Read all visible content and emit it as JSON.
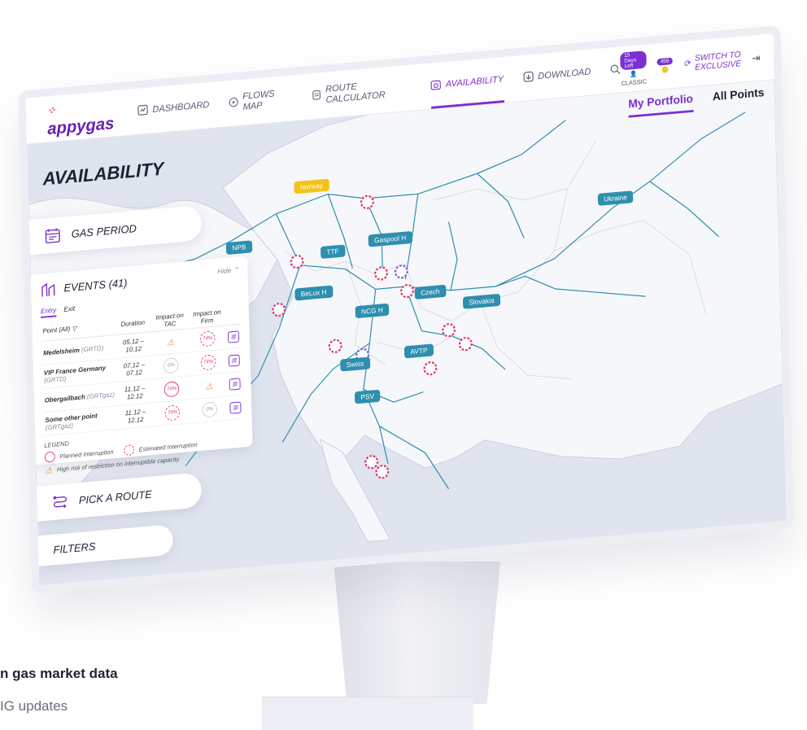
{
  "app": {
    "logo": "appygas",
    "nav": [
      "DASHBOARD",
      "FLOWS MAP",
      "ROUTE CALCULATOR",
      "AVAILABILITY",
      "DOWNLOAD"
    ],
    "active_nav": "AVAILABILITY",
    "user": {
      "days_left": "15 Days Left",
      "plan": "CLASSIC",
      "credits": "456"
    },
    "switch_label_1": "SWITCH TO",
    "switch_label_2": "EXCLUSIVE",
    "view_tabs": {
      "portfolio": "My Portfolio",
      "all": "All Points"
    }
  },
  "page": {
    "title": "AVAILABILITY",
    "gas_period": "GAS PERIOD",
    "pick_route": "PICK A ROUTE",
    "filters": "FILTERS"
  },
  "events": {
    "title": "EVENTS (41)",
    "hide": "Hide",
    "tab_entry": "Entry",
    "tab_exit": "Exit",
    "columns": {
      "point": "Point (All)",
      "duration": "Duration",
      "tac": "Impact on TAC",
      "firm": "Impact on Firm"
    },
    "rows": [
      {
        "point": "Medelsheim",
        "op": "(GRTD)",
        "duration": "05.12 – 10.12",
        "tac": "warn",
        "firm": "74%"
      },
      {
        "point": "VIP France Germany",
        "op": "(GRTD)",
        "duration": "07.12 – 07.12",
        "tac": "0%",
        "firm": "74%"
      },
      {
        "point": "Obergailbach",
        "op": "(GRTgaz)",
        "duration": "11.12 – 12.12",
        "tac": "74%",
        "firm": "warn"
      },
      {
        "point": "Some other point",
        "op": "(GRTgaz)",
        "duration": "11.12 – 12.12",
        "tac": "74%",
        "firm": "0%"
      }
    ],
    "legend_title": "LEGEND",
    "legend_planned": "Planned Interruption",
    "legend_estimated": "Estimated Interruption",
    "legend_risk": "High risk of restriction on interruptible capacity"
  },
  "map_labels": [
    "Norway",
    "NPB",
    "TTF",
    "Gaspool H",
    "BeLux H",
    "NCG H",
    "Czech",
    "Slovakia",
    "Ukraine",
    "AVTP",
    "Swiss",
    "PSV"
  ],
  "tagline": "n gas market data",
  "tagline2": "IG updates"
}
